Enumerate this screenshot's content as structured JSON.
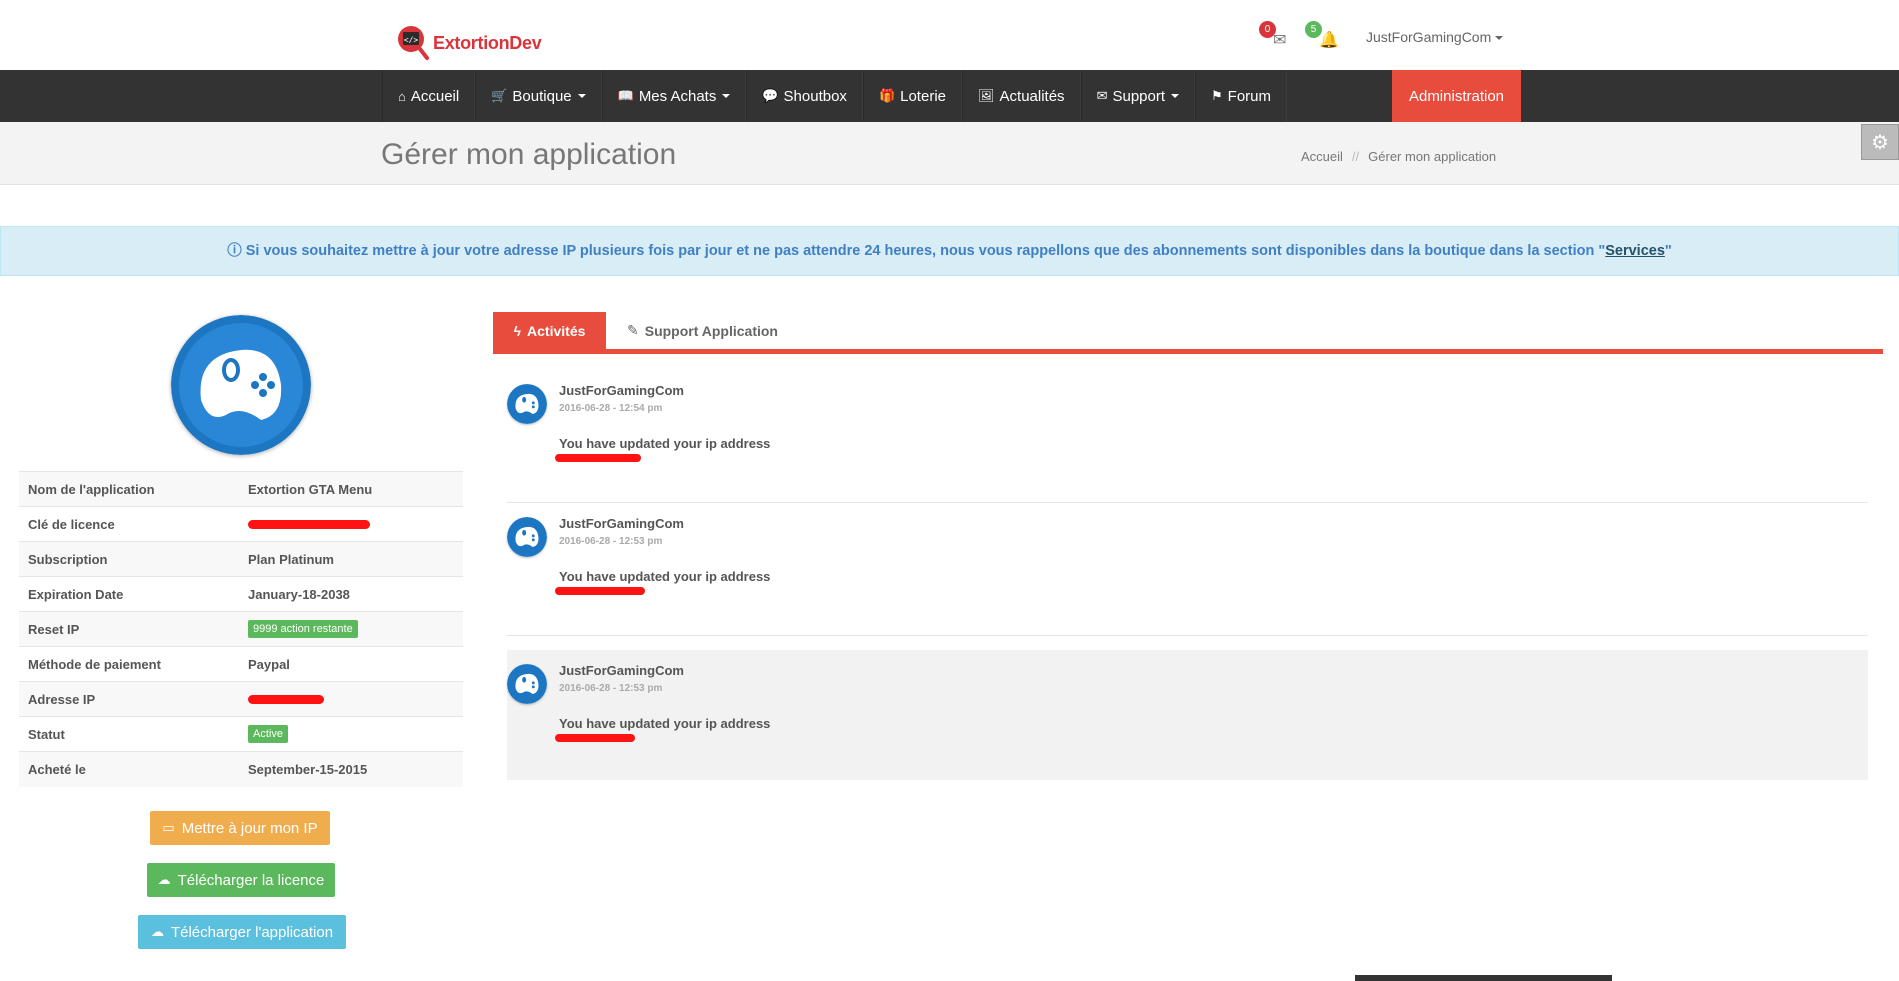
{
  "brand": {
    "name": "ExtortionDev",
    "color": "#d9343a"
  },
  "header": {
    "messages_count": "0",
    "notifications_count": "5",
    "username": "JustForGamingCom"
  },
  "nav": {
    "items": [
      {
        "label": "Accueil",
        "icon": "home-icon",
        "glyph": "⌂"
      },
      {
        "label": "Boutique",
        "icon": "cart-icon",
        "glyph": "🛒",
        "dropdown": true
      },
      {
        "label": "Mes Achats",
        "icon": "book-icon",
        "glyph": "📖",
        "dropdown": true
      },
      {
        "label": "Shoutbox",
        "icon": "comments-icon",
        "glyph": "💬"
      },
      {
        "label": "Loterie",
        "icon": "gift-icon",
        "glyph": "🎁"
      },
      {
        "label": "Actualités",
        "icon": "image-icon",
        "glyph": "🖼"
      },
      {
        "label": "Support",
        "icon": "envelope-icon",
        "glyph": "✉",
        "dropdown": true
      },
      {
        "label": "Forum",
        "icon": "flag-icon",
        "glyph": "⚑"
      }
    ],
    "admin_label": "Administration",
    "background": "#333333",
    "admin_color": "#e74c3c"
  },
  "page": {
    "title": "Gérer mon application",
    "breadcrumb_home": "Accueil",
    "breadcrumb_sep": "//",
    "breadcrumb_current": "Gérer mon application"
  },
  "alert": {
    "text": "Si vous souhaitez mettre à jour votre adresse IP plusieurs fois par jour et ne pas attendre 24 heures, nous vous rappellons que des abonnements sont disponibles dans la boutique dans la section \"",
    "link": "Services",
    "suffix": "\""
  },
  "app_info": {
    "rows": [
      {
        "key": "Nom de l'application",
        "value": "Extortion GTA Menu"
      },
      {
        "key": "Clé de licence",
        "value": ""
      },
      {
        "key": "Subscription",
        "value": "Plan Platinum"
      },
      {
        "key": "Expiration Date",
        "value": "January-18-2038"
      },
      {
        "key": "Reset IP",
        "value": "9999 action restante"
      },
      {
        "key": "Méthode de paiement",
        "value": "Paypal"
      },
      {
        "key": "Adresse IP",
        "value": ""
      },
      {
        "key": "Statut",
        "value": "Active"
      },
      {
        "key": "Acheté le",
        "value": "September-15-2015"
      }
    ]
  },
  "buttons": {
    "update_ip": "Mettre à jour mon IP",
    "download_license": "Télécharger la licence",
    "download_app": "Télécharger l'application",
    "colors": {
      "update_ip": "#f0ad4e",
      "download_license": "#5cb85c",
      "download_app": "#5bc0de"
    }
  },
  "tabs": {
    "activities": "Activités",
    "support": "Support Application"
  },
  "activities": [
    {
      "user": "JustForGamingCom",
      "time": "2016-06-28 - 12:54 pm",
      "text": "You have updated your ip address"
    },
    {
      "user": "JustForGamingCom",
      "time": "2016-06-28 - 12:53 pm",
      "text": "You have updated your ip address"
    },
    {
      "user": "JustForGamingCom",
      "time": "2016-06-28 - 12:53 pm",
      "text": "You have updated your ip address"
    }
  ]
}
